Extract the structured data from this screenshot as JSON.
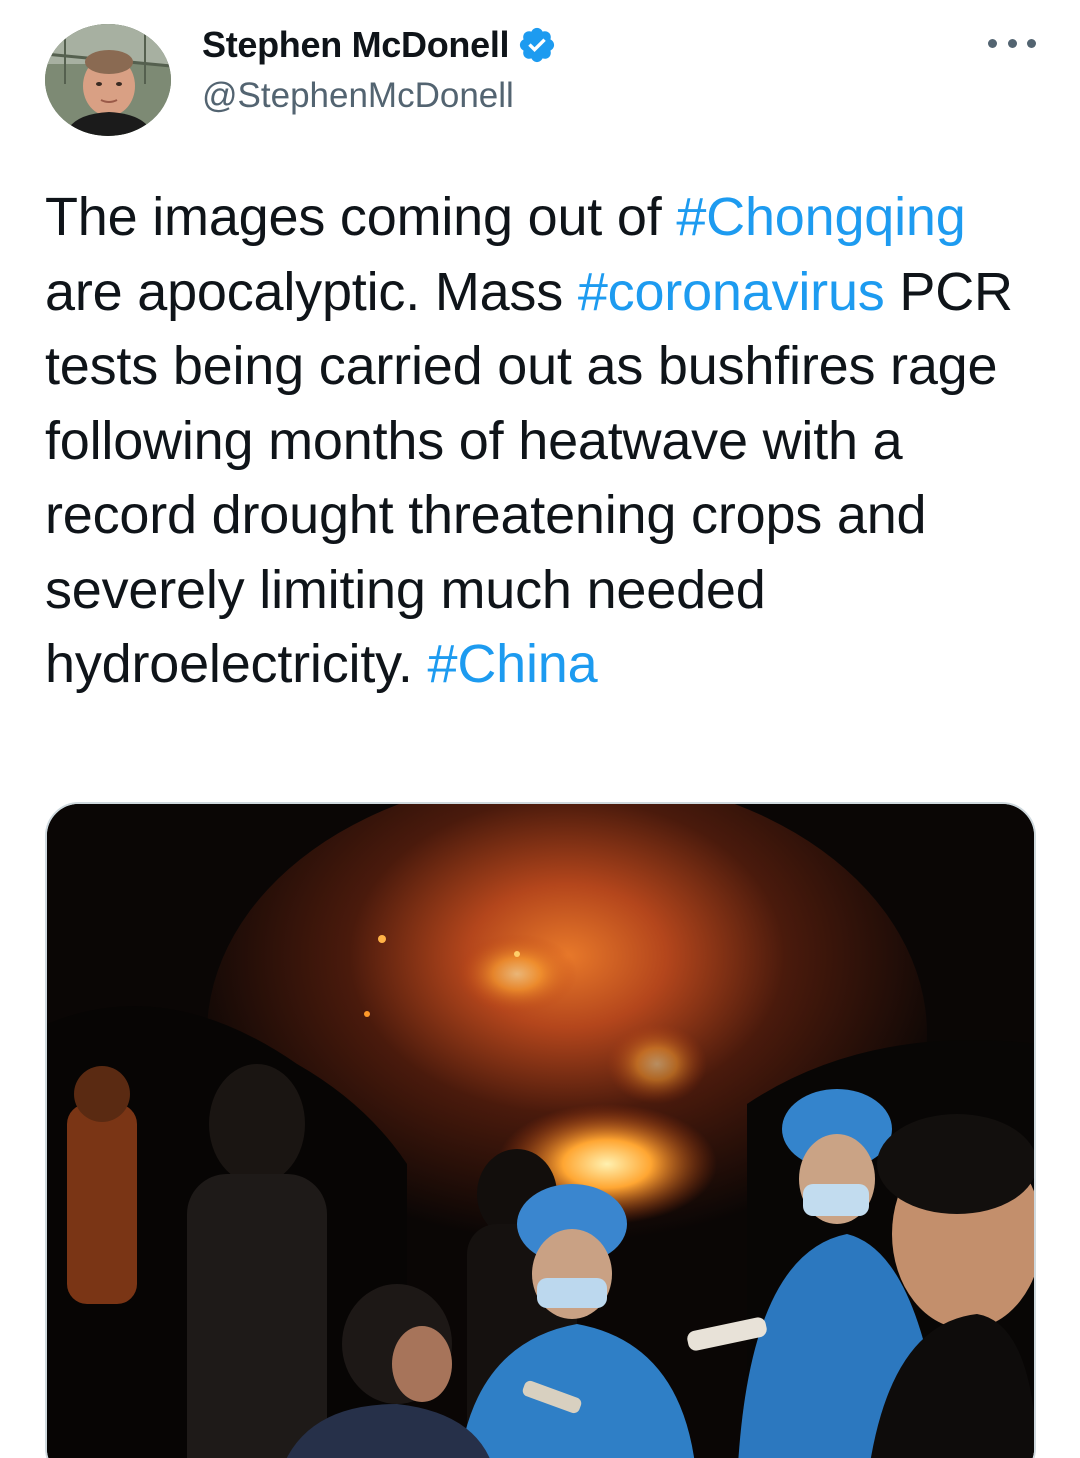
{
  "author": {
    "display_name": "Stephen McDonell",
    "handle": "@StephenMcDonell",
    "verified": true,
    "avatar_icon": "profile-photo"
  },
  "tweet": {
    "segments": [
      {
        "text": "The images coming out of ",
        "type": "text"
      },
      {
        "text": "#Chongqing",
        "type": "hashtag"
      },
      {
        "text": " are apocalyptic. Mass ",
        "type": "text"
      },
      {
        "text": "#coronavirus",
        "type": "hashtag"
      },
      {
        "text": " PCR tests being carried out as bushfires rage following months of heatwave with a record drought threatening crops and severely limiting much needed hydroelectricity. ",
        "type": "text"
      },
      {
        "text": "#China",
        "type": "hashtag"
      }
    ]
  },
  "media": {
    "icon": "photo-night-bushfire-pcr-testing"
  },
  "colors": {
    "link": "#1d9bf0",
    "verified": "#1d9bf0",
    "secondary_text": "#536471",
    "primary_text": "#0f1419"
  },
  "icons": {
    "more": "more-dots-icon",
    "verified": "verified-badge-icon"
  }
}
